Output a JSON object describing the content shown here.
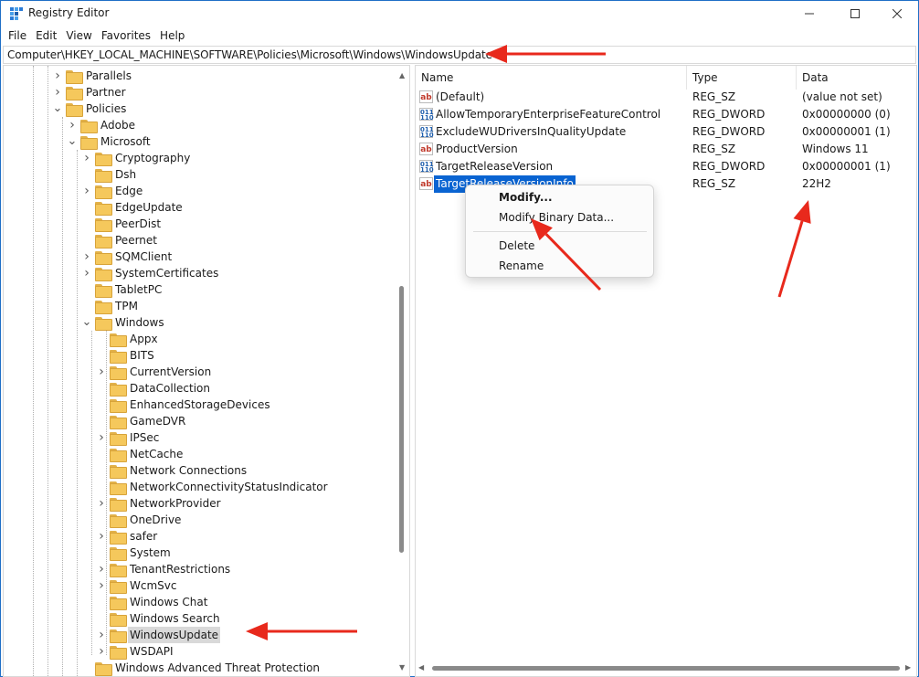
{
  "window": {
    "title": "Registry Editor"
  },
  "menu": [
    "File",
    "Edit",
    "View",
    "Favorites",
    "Help"
  ],
  "address": "Computer\\HKEY_LOCAL_MACHINE\\SOFTWARE\\Policies\\Microsoft\\Windows\\WindowsUpdate",
  "tree": [
    {
      "label": "Parallels",
      "level": 0,
      "expander": "collapsed"
    },
    {
      "label": "Partner",
      "level": 0,
      "expander": "collapsed"
    },
    {
      "label": "Policies",
      "level": 0,
      "expander": "expanded"
    },
    {
      "label": "Adobe",
      "level": 1,
      "expander": "collapsed"
    },
    {
      "label": "Microsoft",
      "level": 1,
      "expander": "expanded"
    },
    {
      "label": "Cryptography",
      "level": 2,
      "expander": "collapsed"
    },
    {
      "label": "Dsh",
      "level": 2,
      "expander": "none"
    },
    {
      "label": "Edge",
      "level": 2,
      "expander": "collapsed"
    },
    {
      "label": "EdgeUpdate",
      "level": 2,
      "expander": "none"
    },
    {
      "label": "PeerDist",
      "level": 2,
      "expander": "none"
    },
    {
      "label": "Peernet",
      "level": 2,
      "expander": "none"
    },
    {
      "label": "SQMClient",
      "level": 2,
      "expander": "collapsed"
    },
    {
      "label": "SystemCertificates",
      "level": 2,
      "expander": "collapsed"
    },
    {
      "label": "TabletPC",
      "level": 2,
      "expander": "none"
    },
    {
      "label": "TPM",
      "level": 2,
      "expander": "none"
    },
    {
      "label": "Windows",
      "level": 2,
      "expander": "expanded"
    },
    {
      "label": "Appx",
      "level": 3,
      "expander": "none"
    },
    {
      "label": "BITS",
      "level": 3,
      "expander": "none"
    },
    {
      "label": "CurrentVersion",
      "level": 3,
      "expander": "collapsed"
    },
    {
      "label": "DataCollection",
      "level": 3,
      "expander": "none"
    },
    {
      "label": "EnhancedStorageDevices",
      "level": 3,
      "expander": "none"
    },
    {
      "label": "GameDVR",
      "level": 3,
      "expander": "none"
    },
    {
      "label": "IPSec",
      "level": 3,
      "expander": "collapsed"
    },
    {
      "label": "NetCache",
      "level": 3,
      "expander": "none"
    },
    {
      "label": "Network Connections",
      "level": 3,
      "expander": "none"
    },
    {
      "label": "NetworkConnectivityStatusIndicator",
      "level": 3,
      "expander": "none"
    },
    {
      "label": "NetworkProvider",
      "level": 3,
      "expander": "collapsed"
    },
    {
      "label": "OneDrive",
      "level": 3,
      "expander": "none"
    },
    {
      "label": "safer",
      "level": 3,
      "expander": "collapsed"
    },
    {
      "label": "System",
      "level": 3,
      "expander": "none"
    },
    {
      "label": "TenantRestrictions",
      "level": 3,
      "expander": "collapsed"
    },
    {
      "label": "WcmSvc",
      "level": 3,
      "expander": "collapsed"
    },
    {
      "label": "Windows Chat",
      "level": 3,
      "expander": "none"
    },
    {
      "label": "Windows Search",
      "level": 3,
      "expander": "none"
    },
    {
      "label": "WindowsUpdate",
      "level": 3,
      "expander": "collapsed",
      "selected": true
    },
    {
      "label": "WSDAPI",
      "level": 3,
      "expander": "collapsed"
    },
    {
      "label": "Windows Advanced Threat Protection",
      "level": 2,
      "expander": "none"
    }
  ],
  "columns": {
    "name": "Name",
    "type": "Type",
    "data": "Data"
  },
  "values": [
    {
      "name": "(Default)",
      "type": "REG_SZ",
      "data": "(value not set)",
      "icon": "string-value-icon"
    },
    {
      "name": "AllowTemporaryEnterpriseFeatureControl",
      "type": "REG_DWORD",
      "data": "0x00000000 (0)",
      "icon": "dword-value-icon"
    },
    {
      "name": "ExcludeWUDriversInQualityUpdate",
      "type": "REG_DWORD",
      "data": "0x00000001 (1)",
      "icon": "dword-value-icon"
    },
    {
      "name": "ProductVersion",
      "type": "REG_SZ",
      "data": "Windows 11",
      "icon": "string-value-icon"
    },
    {
      "name": "TargetReleaseVersion",
      "type": "REG_DWORD",
      "data": "0x00000001 (1)",
      "icon": "dword-value-icon"
    },
    {
      "name": "TargetReleaseVersionInfo",
      "type": "REG_SZ",
      "data": "22H2",
      "icon": "string-value-icon",
      "selected": true
    }
  ],
  "context_menu": {
    "modify": "Modify...",
    "modify_binary": "Modify Binary Data...",
    "delete": "Delete",
    "rename": "Rename"
  },
  "annotation_color": "#e8291c"
}
